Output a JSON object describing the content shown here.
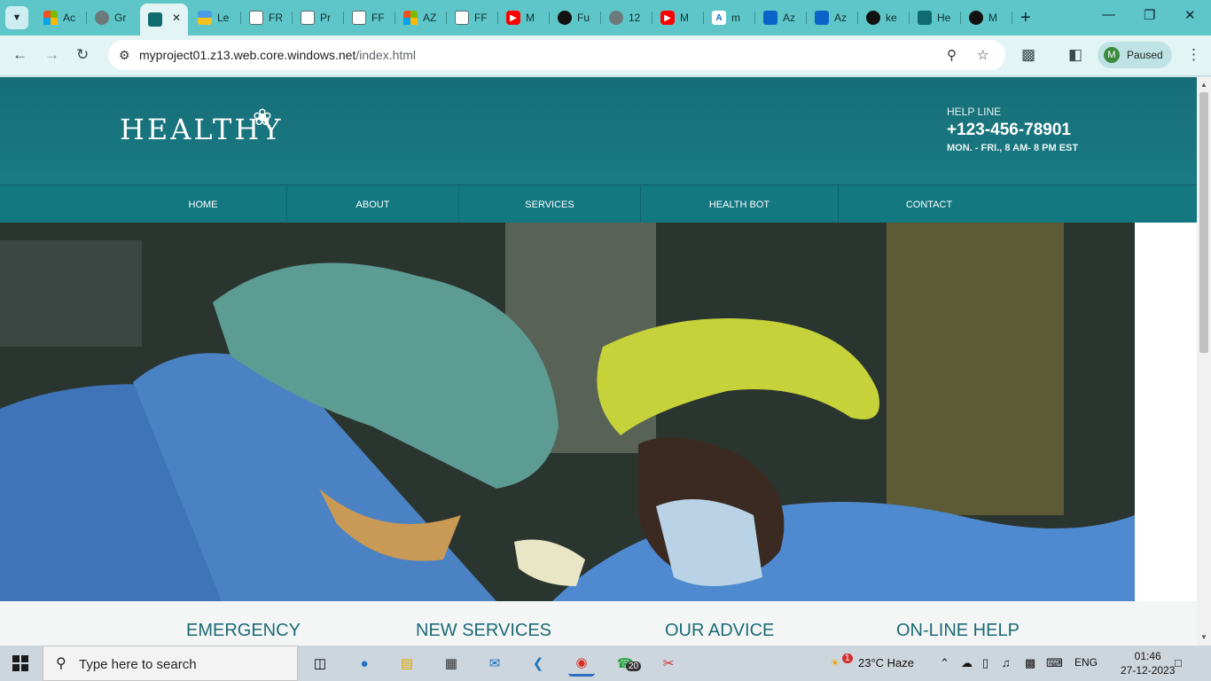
{
  "browser": {
    "tabs": [
      {
        "title": "Ac",
        "icon": "microsoft-icon"
      },
      {
        "title": "Gr",
        "icon": "globe-icon"
      },
      {
        "title": "",
        "icon": "tree-icon",
        "active": true
      },
      {
        "title": "Le",
        "icon": "flag-icon"
      },
      {
        "title": "FR",
        "icon": "document-icon"
      },
      {
        "title": "Pr",
        "icon": "document-icon"
      },
      {
        "title": "FF",
        "icon": "document-icon"
      },
      {
        "title": "AZ",
        "icon": "microsoft-icon"
      },
      {
        "title": "FF",
        "icon": "document-icon"
      },
      {
        "title": "M",
        "icon": "youtube-icon"
      },
      {
        "title": "Fu",
        "icon": "github-icon"
      },
      {
        "title": "12",
        "icon": "globe-icon"
      },
      {
        "title": "M",
        "icon": "youtube-icon"
      },
      {
        "title": "m",
        "icon": "azure-icon"
      },
      {
        "title": "Az",
        "icon": "azure-blue-icon"
      },
      {
        "title": "Az",
        "icon": "azure-blue-icon"
      },
      {
        "title": "ke",
        "icon": "github-icon"
      },
      {
        "title": "He",
        "icon": "tree-icon"
      },
      {
        "title": "M",
        "icon": "github-icon"
      }
    ],
    "url_domain": "myproject01.z13.web.core.windows.net",
    "url_path": "/index.html",
    "profile_initial": "M",
    "profile_status": "Paused"
  },
  "site": {
    "logo_text": "HEALTHY",
    "helpline_label": "HELP LINE",
    "helpline_phone": "+123-456-78901",
    "helpline_hours": "MON. - FRI., 8 AM- 8 PM EST",
    "nav": [
      "HOME",
      "ABOUT",
      "SERVICES",
      "HEALTH BOT",
      "CONTACT"
    ],
    "features": [
      "EMERGENCY",
      "NEW SERVICES",
      "OUR ADVICE",
      "ON-LINE HELP"
    ]
  },
  "taskbar": {
    "search_placeholder": "Type here to search",
    "whatsapp_badge": "20",
    "weather_badge": "1",
    "weather": "23°C  Haze",
    "language": "ENG",
    "time": "01:46",
    "date": "27-12-2023"
  },
  "colors": {
    "header_bg": "#166e77",
    "nav_bg": "#137880",
    "tabstrip_bg": "#5ec6c9",
    "feature_title": "#1c6a74"
  }
}
